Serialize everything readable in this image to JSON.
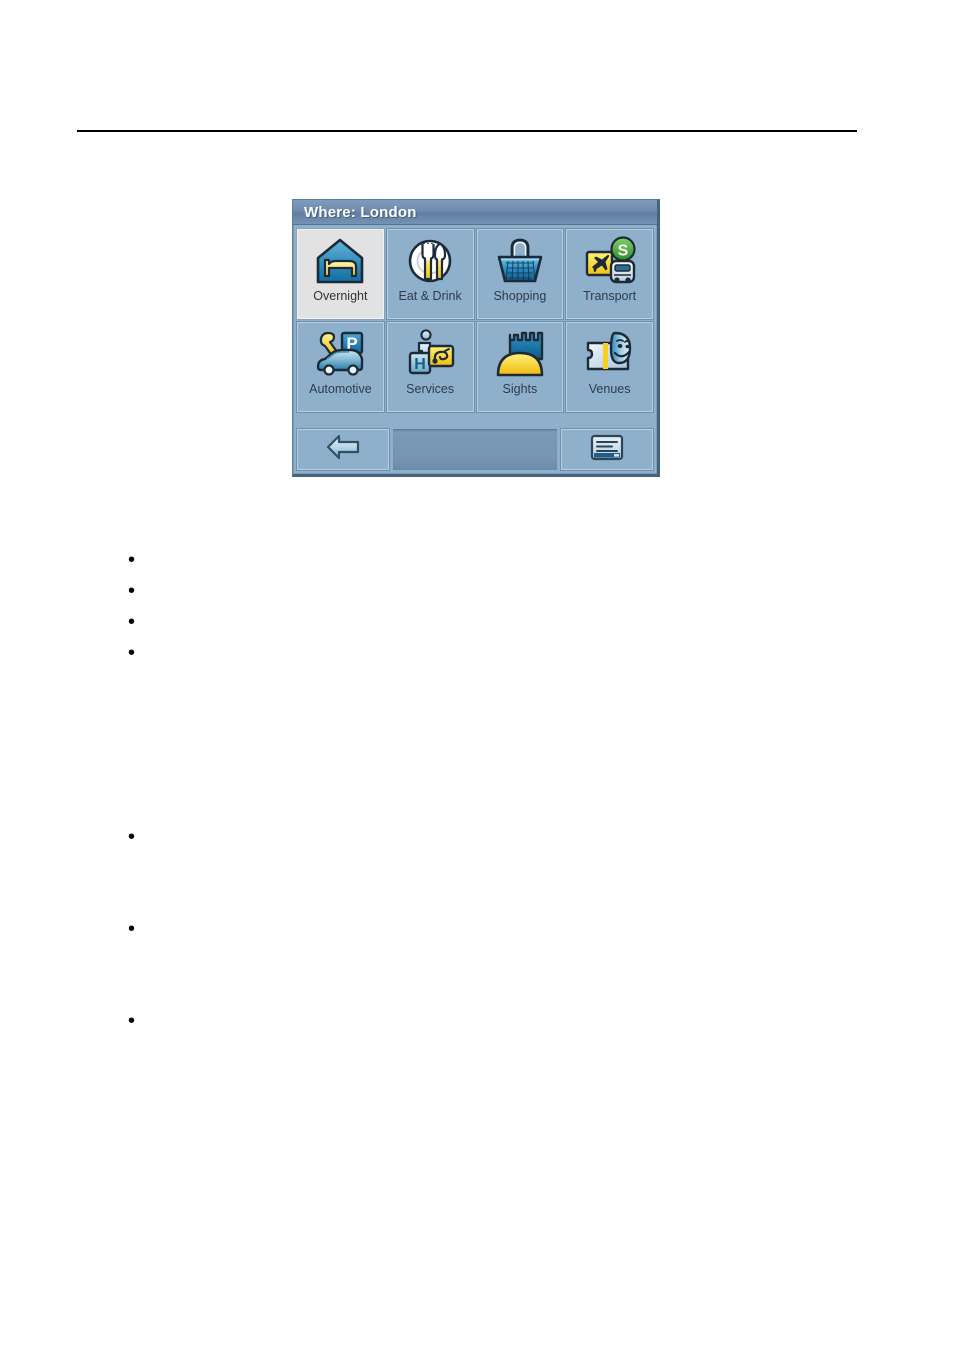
{
  "document": {
    "bullets_upper": [
      "",
      "",
      "",
      ""
    ],
    "bullets_lower": [
      "",
      "",
      ""
    ]
  },
  "device": {
    "titlebar": {
      "title": "Where: London"
    },
    "colors": {
      "screen_background": "#8fb0cb",
      "titlebar": "#6d8cae",
      "tile_background": "#8fb0cb",
      "tile_selected_background": "#e2e2e2",
      "tile_border_light": "#b9cddf",
      "label_text": "#2d3c4b",
      "title_text": "#ffffff",
      "accent_yellow": "#ffd92e",
      "accent_green": "#4cae3f",
      "icon_blue": "#2b7fb5"
    },
    "tiles": [
      {
        "label": "Overnight",
        "icon": "bed-house-icon",
        "selected": true
      },
      {
        "label": "Eat & Drink",
        "icon": "plate-cutlery-icon",
        "selected": false
      },
      {
        "label": "Shopping",
        "icon": "shopping-basket-icon",
        "selected": false
      },
      {
        "label": "Transport",
        "icon": "plane-bus-sbahn-icon",
        "selected": false
      },
      {
        "label": "Automotive",
        "icon": "car-wrench-parking-icon",
        "selected": false
      },
      {
        "label": "Services",
        "icon": "info-hospital-post-icon",
        "selected": false
      },
      {
        "label": "Sights",
        "icon": "castle-hill-icon",
        "selected": false
      },
      {
        "label": "Venues",
        "icon": "ticket-mask-icon",
        "selected": false
      }
    ],
    "toolbar": {
      "back_label": "Back",
      "back_icon": "left-arrow-icon",
      "menu_label": "Menu",
      "menu_icon": "keyboard-menu-icon"
    }
  }
}
